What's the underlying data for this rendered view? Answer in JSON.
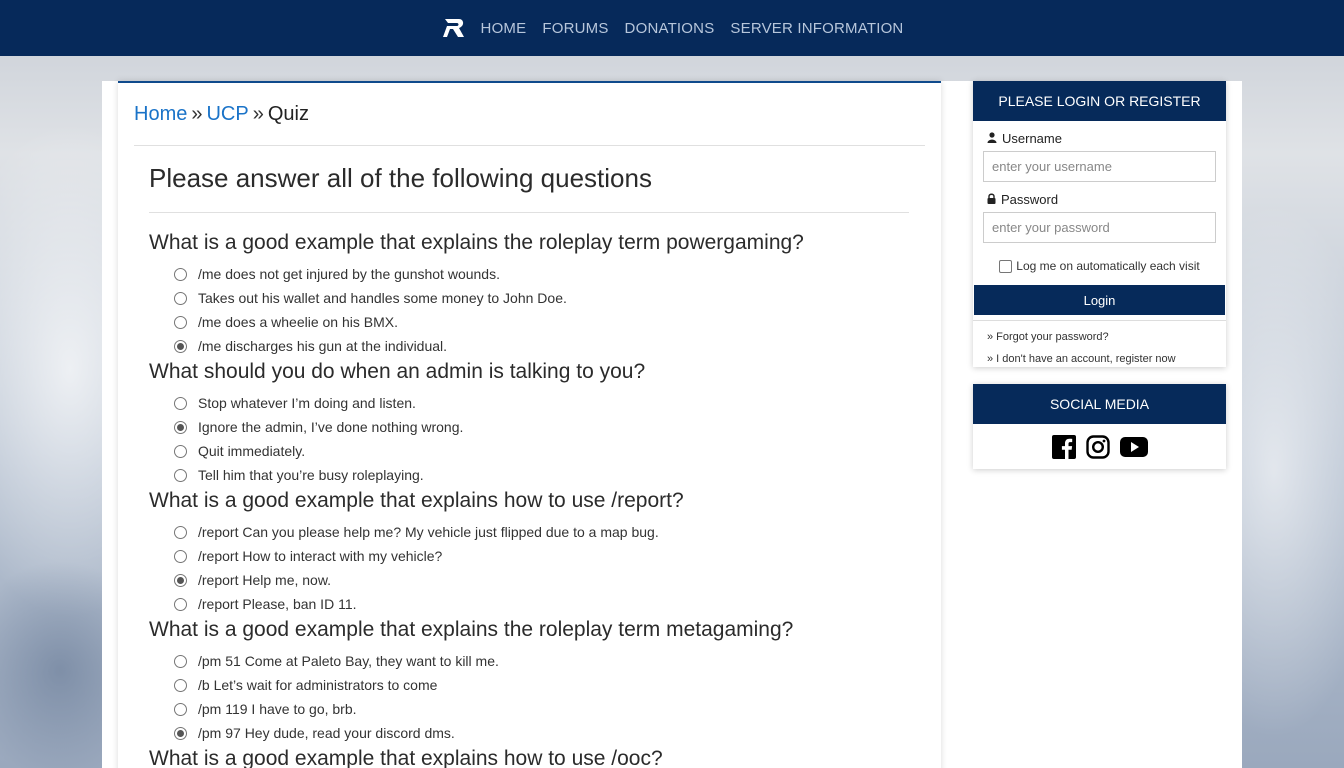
{
  "nav": {
    "items": [
      {
        "label": "HOME"
      },
      {
        "label": "FORUMS"
      },
      {
        "label": "DONATIONS"
      },
      {
        "label": "SERVER INFORMATION"
      }
    ]
  },
  "breadcrumb": {
    "home": "Home",
    "ucp": "UCP",
    "separator": "»",
    "current": "Quiz"
  },
  "page_title": "Please answer all of the following questions",
  "questions": [
    {
      "text": "What is a good example that explains the roleplay term powergaming?",
      "options": [
        "/me does not get injured by the gunshot wounds.",
        "Takes out his wallet and handles some money to John Doe.",
        "/me does a wheelie on his BMX.",
        "/me discharges his gun at the individual."
      ],
      "selected": 3
    },
    {
      "text": "What should you do when an admin is talking to you?",
      "options": [
        "Stop whatever I’m doing and listen.",
        "Ignore the admin, I’ve done nothing wrong.",
        "Quit immediately.",
        "Tell him that you’re busy roleplaying."
      ],
      "selected": 1
    },
    {
      "text": "What is a good example that explains how to use /report?",
      "options": [
        "/report Can you please help me? My vehicle just flipped due to a map bug.",
        "/report How to interact with my vehicle?",
        "/report Help me, now.",
        "/report Please, ban ID 11."
      ],
      "selected": 2
    },
    {
      "text": "What is a good example that explains the roleplay term metagaming?",
      "options": [
        "/pm 51 Come at Paleto Bay, they want to kill me.",
        "/b Let’s wait for administrators to come",
        "/pm 119 I have to go, brb.",
        "/pm 97 Hey dude, read your discord dms."
      ],
      "selected": 3
    },
    {
      "text": "What is a good example that explains how to use /ooc?",
      "options": [],
      "selected": null
    }
  ],
  "login": {
    "header": "PLEASE LOGIN OR REGISTER",
    "username_label": "Username",
    "username_placeholder": "enter your username",
    "password_label": "Password",
    "password_placeholder": "enter your password",
    "remember_label": "Log me on automatically each visit",
    "button": "Login",
    "forgot": "» Forgot your password?",
    "register": "» I don't have an account, register now"
  },
  "social": {
    "header": "SOCIAL MEDIA",
    "icons": [
      "facebook-icon",
      "instagram-icon",
      "youtube-icon"
    ]
  },
  "colors": {
    "nav_bg": "#06295a",
    "link": "#1a73c8",
    "card_head": "#062a5a"
  }
}
